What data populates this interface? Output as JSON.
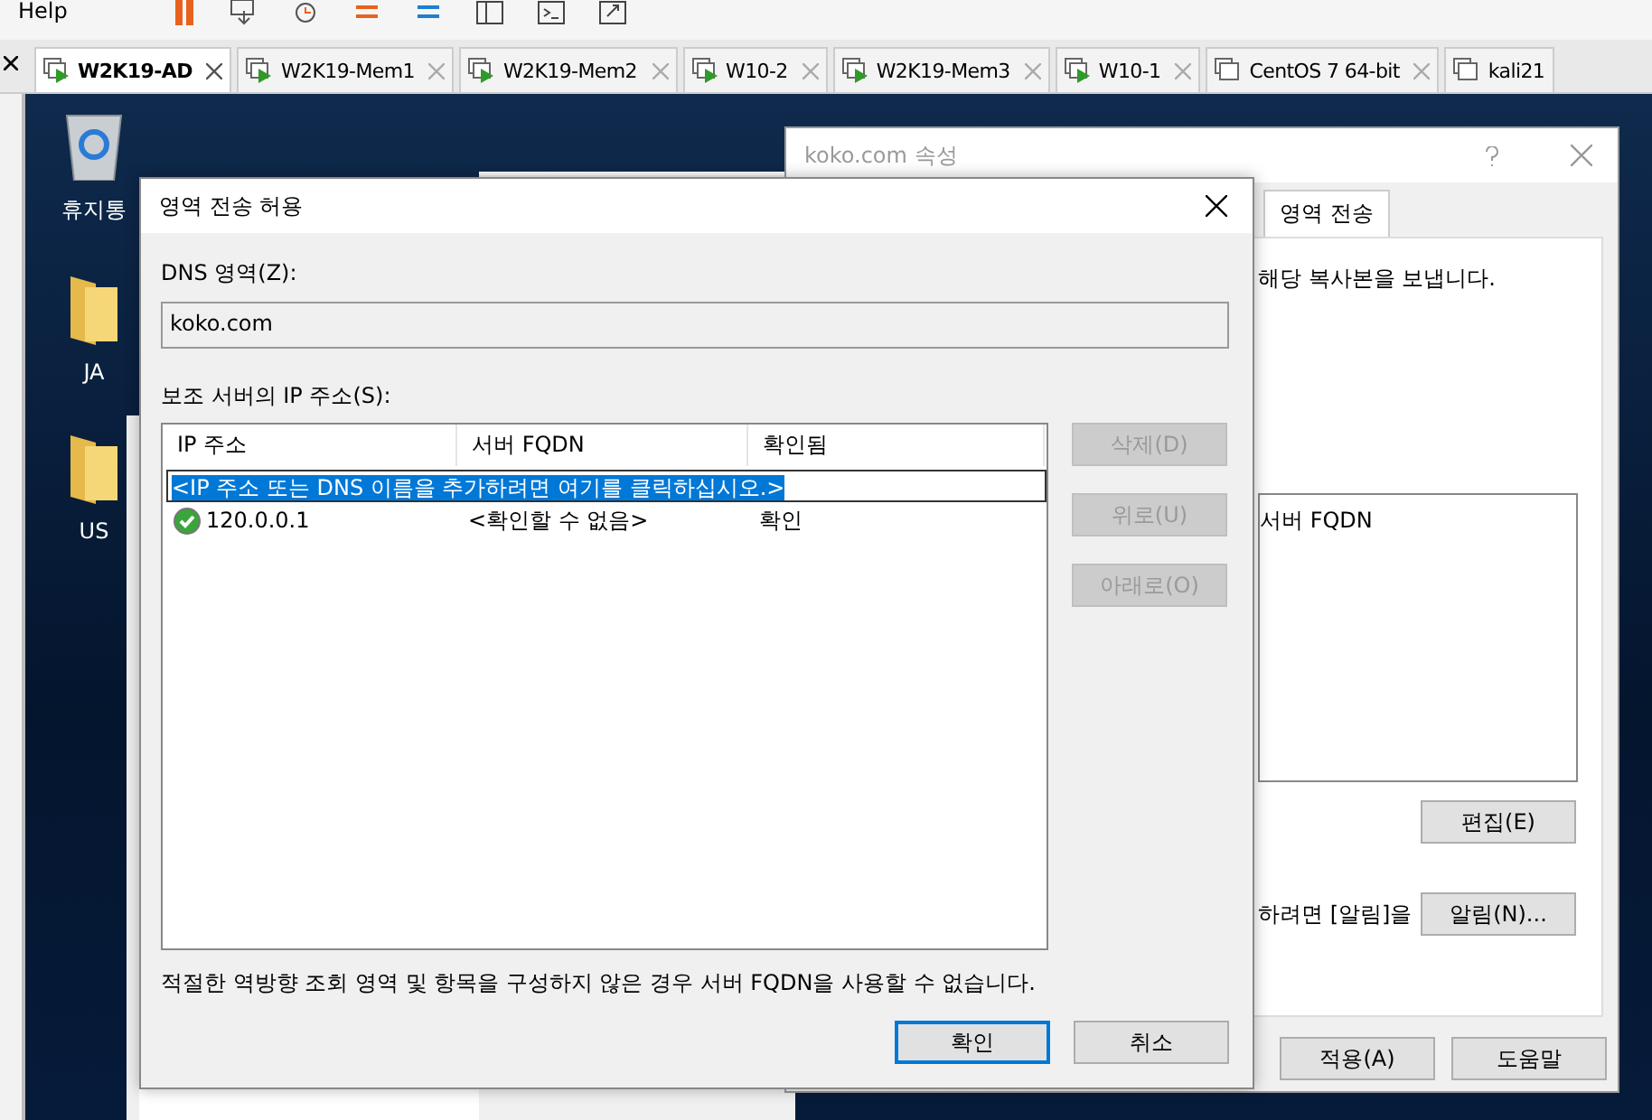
{
  "menu": {
    "items": [
      "Help"
    ]
  },
  "vm_tabs": [
    {
      "label": "W2K19-AD",
      "selected": true,
      "running": true,
      "closable": true
    },
    {
      "label": "W2K19-Mem1",
      "selected": false,
      "running": true,
      "closable": true
    },
    {
      "label": "W2K19-Mem2",
      "selected": false,
      "running": true,
      "closable": true
    },
    {
      "label": "W10-2",
      "selected": false,
      "running": true,
      "closable": true
    },
    {
      "label": "W2K19-Mem3",
      "selected": false,
      "running": true,
      "closable": true
    },
    {
      "label": "W10-1",
      "selected": false,
      "running": true,
      "closable": true
    },
    {
      "label": "CentOS 7 64-bit",
      "selected": false,
      "running": false,
      "closable": true
    },
    {
      "label": "kali21",
      "selected": false,
      "running": false,
      "closable": false
    }
  ],
  "desktop_icons": [
    {
      "label": "휴지통",
      "kind": "recycle-bin"
    },
    {
      "label": "JA",
      "kind": "folder"
    },
    {
      "label": "US",
      "kind": "folder"
    }
  ],
  "properties_dialog": {
    "title": "koko.com 속성",
    "tabs": [
      {
        "label": "영역 전송",
        "selected": true
      }
    ],
    "description": "해당 복사본을 보냅니다.",
    "list_columns": [
      "서버 FQDN"
    ],
    "edit_button": "편집(E)",
    "notify_text": "하려면 [알림]을",
    "notify_button": "알림(N)...",
    "buttons": [
      "적용(A)",
      "도움말"
    ]
  },
  "zone_transfer_dialog": {
    "title": "영역 전송 허용",
    "zone_label": "DNS 영역(Z):",
    "zone_value": "koko.com",
    "servers_label": "보조 서버의 IP 주소(S):",
    "columns": [
      "IP 주소",
      "서버 FQDN",
      "확인됨"
    ],
    "new_entry": {
      "value": "<IP 주소 또는 DNS 이름을 추가하려면 여기를 클릭하십시오.>",
      "selected": true
    },
    "rows": [
      {
        "ip": "120.0.0.1",
        "fqdn": "<확인할 수 없음>",
        "status": "확인",
        "validated": true
      }
    ],
    "side_buttons": [
      {
        "label": "삭제(D)",
        "disabled": true
      },
      {
        "label": "위로(U)",
        "disabled": true
      },
      {
        "label": "아래로(O)",
        "disabled": true
      }
    ],
    "note": "적절한 역방향 조회 영역 및 항목을 구성하지 않은 경우 서버 FQDN을 사용할 수 없습니다.",
    "buttons": [
      {
        "label": "확인",
        "default": true
      },
      {
        "label": "취소",
        "default": false
      }
    ]
  }
}
